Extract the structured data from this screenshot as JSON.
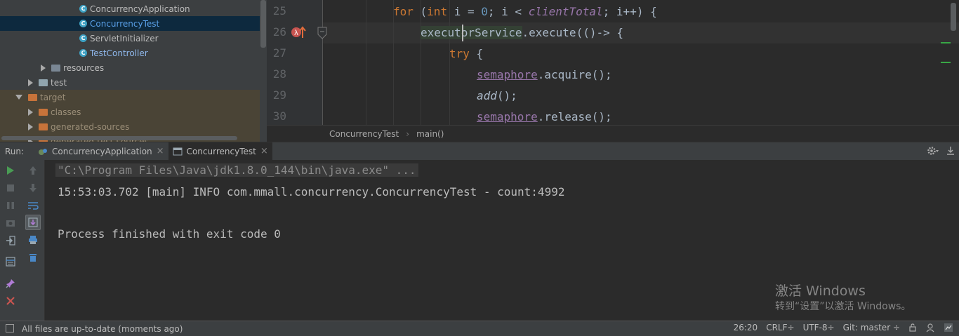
{
  "project_tree": {
    "items": [
      {
        "label": "ConcurrencyApplication"
      },
      {
        "label": "ConcurrencyTest"
      },
      {
        "label": "ServletInitializer"
      },
      {
        "label": "TestController"
      },
      {
        "label": "resources"
      },
      {
        "label": "test"
      },
      {
        "label": "target"
      },
      {
        "label": "classes"
      },
      {
        "label": "generated-sources"
      },
      {
        "label": "generated-test-sources"
      }
    ]
  },
  "editor": {
    "line_numbers": [
      "25",
      "26",
      "27",
      "28",
      "29",
      "30"
    ],
    "lines": {
      "l25": {
        "kw_for": "for",
        "paren": " (",
        "kw_int": "int",
        "mid": " i = ",
        "num": "0",
        "semi": "; i < ",
        "field": "clientTotal",
        "end": "; i++) {"
      },
      "l26": {
        "obj": "executorService",
        "rest": ".execute(()-> {"
      },
      "l27": {
        "kw_try": "try",
        "rest": " {"
      },
      "l28": {
        "field": "semaphore",
        "rest": ".acquire();"
      },
      "l29": {
        "call": "add",
        "rest": "();"
      },
      "l30": {
        "field": "semaphore",
        "rest": ".release();"
      }
    },
    "breadcrumb": [
      "ConcurrencyTest",
      "main()"
    ]
  },
  "run": {
    "label": "Run:",
    "tabs": [
      {
        "label": "ConcurrencyApplication",
        "close": "×"
      },
      {
        "label": "ConcurrencyTest",
        "close": "×"
      }
    ],
    "console": [
      "\"C:\\Program Files\\Java\\jdk1.8.0_144\\bin\\java.exe\" ...",
      "15:53:03.702 [main] INFO com.mmall.concurrency.ConcurrencyTest - count:4992",
      "Process finished with exit code 0"
    ]
  },
  "watermark": {
    "title": "激活 Windows",
    "subtitle": "转到“设置”以激活 Windows。"
  },
  "status_bar": {
    "message": "All files are up-to-date (moments ago)",
    "position": "26:20",
    "line_sep": "CRLF÷",
    "encoding": "UTF-8÷",
    "vcs": "Git: master ÷"
  },
  "colors": {
    "keyword": "#cc7832",
    "number": "#6897bb",
    "field": "#9876aa",
    "selection": "#0d293e",
    "run_green": "#499c54",
    "stop_red": "#c75450"
  },
  "icons": {
    "run": "play-icon",
    "stop": "stop-icon",
    "pause": "pause-icon",
    "settings": "gear-icon",
    "close": "close-icon"
  }
}
